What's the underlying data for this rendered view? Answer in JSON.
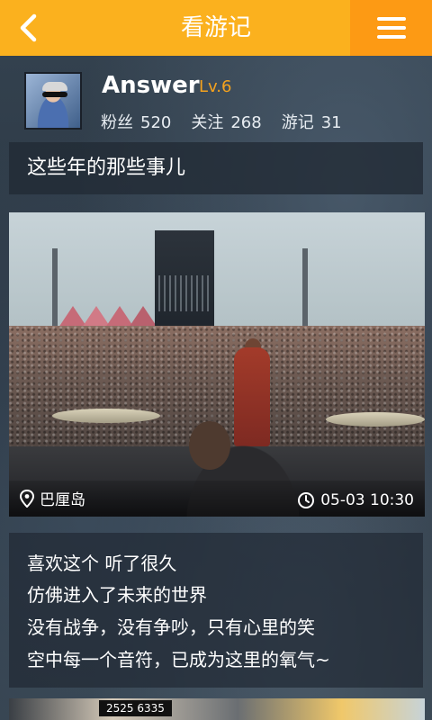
{
  "header": {
    "title": "看游记",
    "back_icon": "chevron-left-icon",
    "menu_icon": "hamburger-menu-icon",
    "accent": "#fbb11e",
    "accent_dark": "#fd9a14"
  },
  "profile": {
    "username": "Answer",
    "level": "Lv.6",
    "stats": [
      {
        "label": "粉丝",
        "value": "520"
      },
      {
        "label": "关注",
        "value": "268"
      },
      {
        "label": "游记",
        "value": "31"
      }
    ]
  },
  "note": {
    "title": "这些年的那些事儿",
    "photo": {
      "location": "巴厘岛",
      "location_icon": "location-pin-icon",
      "time": "05-03 10:30",
      "time_icon": "clock-icon"
    },
    "lines": [
      "喜欢这个  听了很久",
      "仿佛进入了未来的世界",
      "没有战争，没有争吵，只有心里的笑",
      "空中每一个音符，已成为这里的氧气~"
    ]
  },
  "next_card": {
    "sign_text": "2525 6335"
  }
}
